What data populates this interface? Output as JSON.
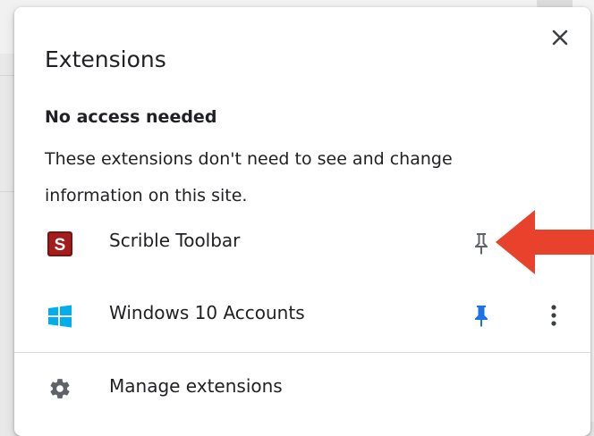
{
  "popup": {
    "title": "Extensions",
    "close_icon": "close-icon",
    "section_heading": "No access needed",
    "section_description": "These extensions don't need to see and change information on this site."
  },
  "extensions": [
    {
      "name": "Scrible Toolbar",
      "icon": "scrible-logo-icon",
      "icon_letter": "S",
      "pinned": false,
      "pin_color": "#5f6368",
      "has_more_menu": false
    },
    {
      "name": "Windows 10 Accounts",
      "icon": "windows-logo-icon",
      "pinned": true,
      "pin_color": "#1a73e8",
      "has_more_menu": true
    }
  ],
  "footer": {
    "manage_label": "Manage extensions",
    "manage_icon": "gear-icon"
  },
  "annotation": {
    "arrow_color": "#e8412c",
    "points_to": "pin button for Scrible Toolbar"
  },
  "colors": {
    "text": "#202124",
    "pin_active": "#1a73e8",
    "pin_inactive": "#5f6368",
    "scrible_red": "#a51c1c",
    "windows_blue": "#00adef"
  }
}
